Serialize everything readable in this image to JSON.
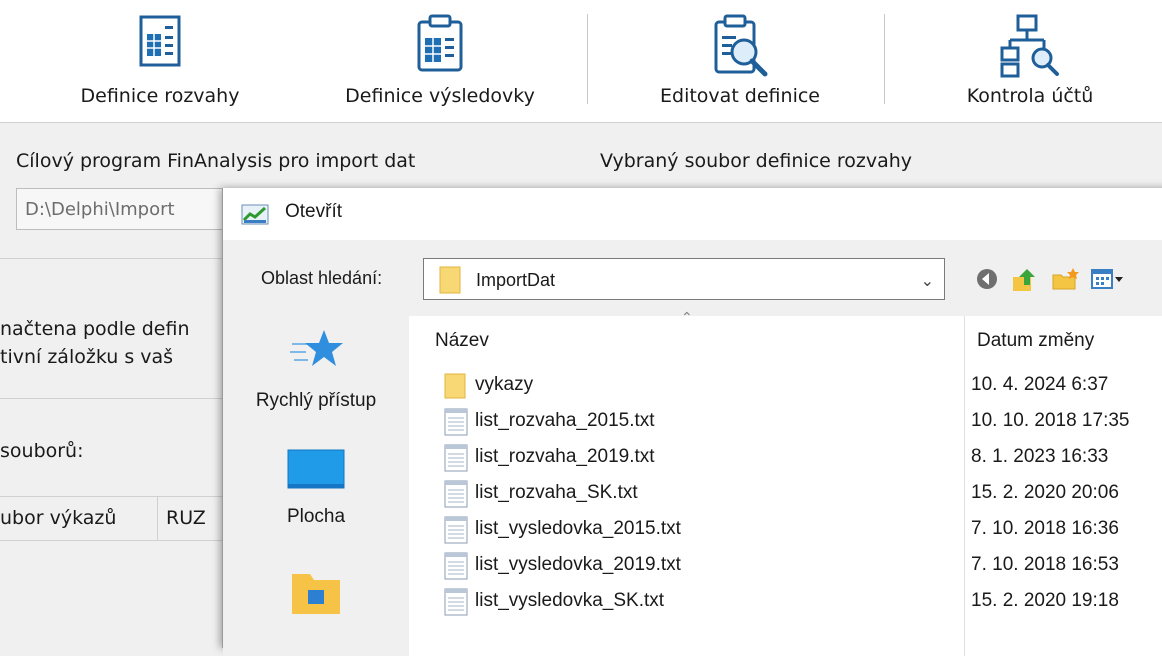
{
  "toolbar": {
    "buttons": [
      {
        "label": "Definice rozvahy",
        "icon": "balance-sheet-icon"
      },
      {
        "label": "Definice výsledovky",
        "icon": "income-statement-icon"
      },
      {
        "label": "Editovat definice",
        "icon": "edit-definitions-icon"
      },
      {
        "label": "Kontrola účtů",
        "icon": "account-check-icon"
      }
    ]
  },
  "main": {
    "target_label": "Cílový program FinAnalysis pro import dat",
    "selected_label": "Vybraný soubor definice rozvahy",
    "path_value": "D:\\Delphi\\Import",
    "info_line1": "načtena podle defin",
    "info_line2": "tivní záložku s vaš",
    "files_label": "souborů:",
    "col1": "ubor výkazů",
    "col2": "RUZ"
  },
  "dialog": {
    "title": "Otevřít",
    "look_in_label": "Oblast hledání:",
    "look_in_value": "ImportDat",
    "places": [
      {
        "label": "Rychlý přístup",
        "icon": "star-icon"
      },
      {
        "label": "Plocha",
        "icon": "desktop-icon"
      },
      {
        "label": "",
        "icon": "library-icon"
      }
    ],
    "headers": {
      "name": "Název",
      "date": "Datum změny"
    },
    "files": [
      {
        "name": "vykazy",
        "date": "10. 4. 2024 6:37",
        "type": "folder"
      },
      {
        "name": "list_rozvaha_2015.txt",
        "date": "10. 10. 2018 17:35",
        "type": "txt"
      },
      {
        "name": "list_rozvaha_2019.txt",
        "date": "8. 1. 2023 16:33",
        "type": "txt"
      },
      {
        "name": "list_rozvaha_SK.txt",
        "date": "15. 2. 2020 20:06",
        "type": "txt"
      },
      {
        "name": "list_vysledovka_2015.txt",
        "date": "7. 10. 2018 16:36",
        "type": "txt"
      },
      {
        "name": "list_vysledovka_2019.txt",
        "date": "7. 10. 2018 16:53",
        "type": "txt"
      },
      {
        "name": "list_vysledovka_SK.txt",
        "date": "15. 2. 2020 19:18",
        "type": "txt"
      }
    ]
  },
  "colors": {
    "accent": "#1a6fb3",
    "folder": "#f6c94a"
  }
}
